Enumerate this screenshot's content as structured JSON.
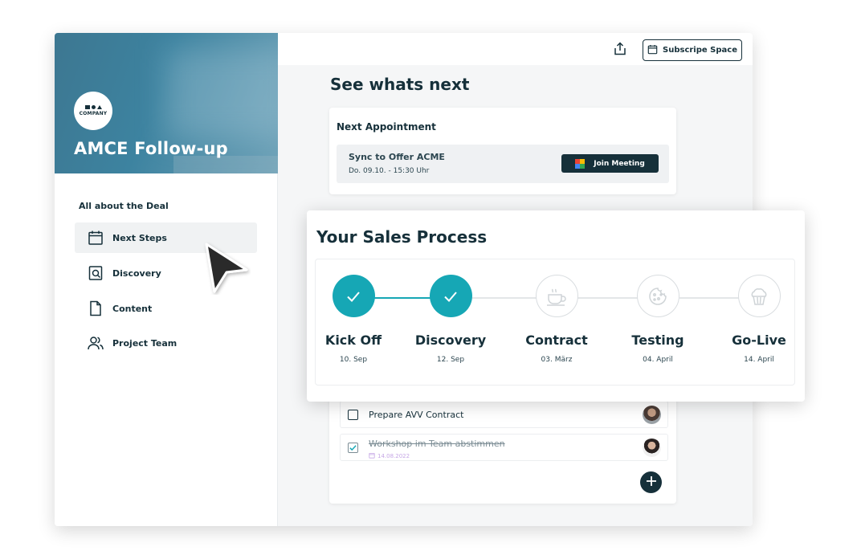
{
  "sidebar": {
    "logo_text": "COMPANY",
    "title": "AMCE Follow-up",
    "section_label": "All about the Deal",
    "items": [
      {
        "label": "Next Steps",
        "icon": "calendar-icon",
        "active": true
      },
      {
        "label": "Discovery",
        "icon": "search-document-icon",
        "active": false
      },
      {
        "label": "Content",
        "icon": "document-icon",
        "active": false
      },
      {
        "label": "Project Team",
        "icon": "users-icon",
        "active": false
      }
    ]
  },
  "toolbar": {
    "share_icon": "share-icon",
    "subscribe_label": "Subscripe Space"
  },
  "main": {
    "title": "See whats next",
    "appointment": {
      "heading": "Next Appointment",
      "name": "Sync to Offer ACME",
      "time": "Do. 09.10. - 15:30 Uhr",
      "join_label": "Join Meeting"
    },
    "todos": [
      {
        "text": "Prepare AVV Contract",
        "done": false,
        "date": ""
      },
      {
        "text": "Workshop im Team abstimmen",
        "done": true,
        "date": "14.08.2022"
      }
    ]
  },
  "sales_process": {
    "title": "Your Sales Process",
    "steps": [
      {
        "label": "Kick Off",
        "date": "10. Sep",
        "done": true,
        "icon": "check-icon"
      },
      {
        "label": "Discovery",
        "date": "12. Sep",
        "done": true,
        "icon": "check-icon"
      },
      {
        "label": "Contract",
        "date": "03. März",
        "done": false,
        "icon": "coffee-icon"
      },
      {
        "label": "Testing",
        "date": "04. April",
        "done": false,
        "icon": "cookie-icon"
      },
      {
        "label": "Go-Live",
        "date": "14. April",
        "done": false,
        "icon": "muffin-icon"
      }
    ]
  },
  "colors": {
    "primary": "#16303a",
    "accent": "#16a7b5",
    "hero": "#3d7791"
  }
}
